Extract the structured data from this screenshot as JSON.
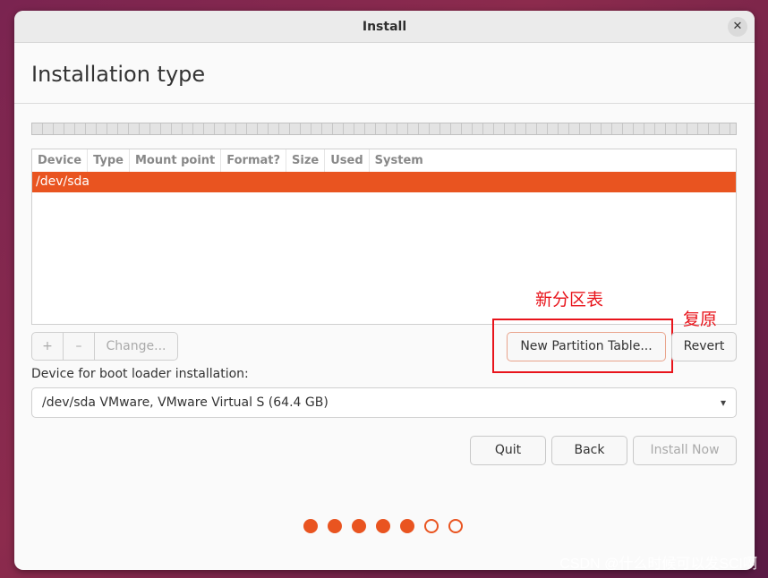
{
  "window": {
    "title": "Install",
    "close_glyph": "✕"
  },
  "page": {
    "title": "Installation type"
  },
  "table": {
    "columns": [
      "Device",
      "Type",
      "Mount point",
      "Format?",
      "Size",
      "Used",
      "System"
    ],
    "rows": [
      "/dev/sda"
    ]
  },
  "toolbar": {
    "add": "+",
    "remove": "–",
    "change": "Change..."
  },
  "buttons": {
    "new_partition_table": "New Partition Table...",
    "revert": "Revert",
    "quit": "Quit",
    "back": "Back",
    "install_now": "Install Now"
  },
  "annotations": {
    "new_table": "新分区表",
    "revert": "复原"
  },
  "boot_loader": {
    "label": "Device for boot loader installation:",
    "selected": "/dev/sda VMware, VMware Virtual S (64.4 GB)",
    "chevron": "▾"
  },
  "progress": {
    "total_steps": 7,
    "completed_steps": 5
  },
  "watermark": "CSDN @什么时候可以发SCI啊",
  "colors": {
    "accent": "#e95420",
    "annotation": "#e8141b"
  }
}
